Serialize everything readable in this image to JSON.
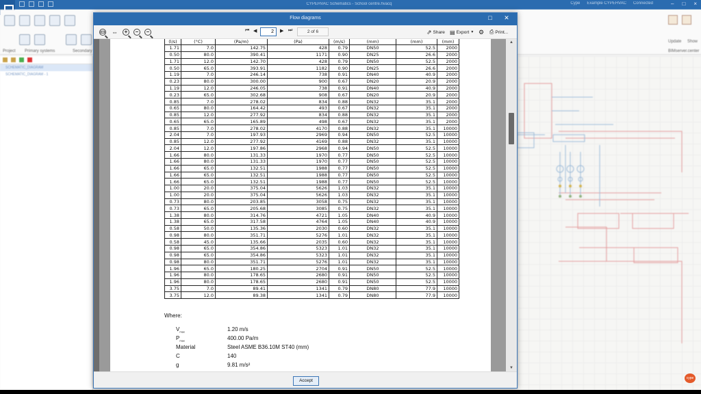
{
  "app": {
    "title": "CYPEHVAC Schematics - School centre.hvacq",
    "right_items": [
      "Cype",
      "Example CYPEHVAC",
      "Connected"
    ],
    "ribbon": {
      "left_group_label": "Primary systems",
      "right_group_label": "Secondary",
      "left_tab": "Project",
      "right_labels": [
        "Update",
        "Show"
      ],
      "right_section": "BIMserver.center"
    },
    "left_panel": {
      "rows": [
        "SCHEMATIC_DIAGRAM",
        "SCHEMATIC_DIAGRAM - 1"
      ]
    },
    "badge": "cype"
  },
  "dialog": {
    "title": "Flow diagrams",
    "toolbar": {
      "page_current": "2",
      "page_of": "2 of 6",
      "share_label": "Share",
      "export_label": "Export",
      "print_label": "Print..."
    },
    "accept_label": "Accept"
  },
  "report": {
    "units_header": [
      "(l/s)",
      "(°C)",
      "(Pa/m)",
      "(Pa)",
      "(m/s)",
      "(mm)",
      "(mm)",
      "(mm)"
    ],
    "rows": [
      [
        "1.71",
        "7.0",
        "142.75",
        "428",
        "0.79",
        "DN50",
        "52.5",
        "2000"
      ],
      [
        "0.50",
        "80.0",
        "390.41",
        "1171",
        "0.90",
        "DN25",
        "26.6",
        "2000"
      ],
      [
        "1.71",
        "12.0",
        "142.70",
        "428",
        "0.79",
        "DN50",
        "52.5",
        "2000"
      ],
      [
        "0.50",
        "65.0",
        "393.91",
        "1182",
        "0.90",
        "DN25",
        "26.6",
        "2000"
      ],
      [
        "1.19",
        "7.0",
        "246.14",
        "738",
        "0.91",
        "DN40",
        "40.9",
        "2000"
      ],
      [
        "0.23",
        "80.0",
        "300.00",
        "900",
        "0.67",
        "DN20",
        "20.9",
        "2000"
      ],
      [
        "1.19",
        "12.0",
        "246.05",
        "738",
        "0.91",
        "DN40",
        "40.9",
        "2000"
      ],
      [
        "0.23",
        "65.0",
        "302.68",
        "908",
        "0.67",
        "DN20",
        "20.9",
        "2000"
      ],
      [
        "0.85",
        "7.0",
        "278.02",
        "834",
        "0.88",
        "DN32",
        "35.1",
        "2000"
      ],
      [
        "0.65",
        "80.0",
        "164.42",
        "493",
        "0.67",
        "DN32",
        "35.1",
        "2000"
      ],
      [
        "0.85",
        "12.0",
        "277.92",
        "834",
        "0.88",
        "DN32",
        "35.1",
        "2000"
      ],
      [
        "0.65",
        "65.0",
        "165.89",
        "498",
        "0.67",
        "DN32",
        "35.1",
        "2000"
      ],
      [
        "0.85",
        "7.0",
        "278.02",
        "4170",
        "0.88",
        "DN32",
        "35.1",
        "10000"
      ],
      [
        "2.04",
        "7.0",
        "197.93",
        "2969",
        "0.94",
        "DN50",
        "52.5",
        "10000"
      ],
      [
        "0.85",
        "12.0",
        "277.92",
        "4169",
        "0.88",
        "DN32",
        "35.1",
        "10000"
      ],
      [
        "2.04",
        "12.0",
        "197.86",
        "2968",
        "0.94",
        "DN50",
        "52.5",
        "10000"
      ],
      [
        "1.66",
        "80.0",
        "131.33",
        "1970",
        "0.77",
        "DN50",
        "52.5",
        "10000"
      ],
      [
        "1.66",
        "80.0",
        "131.33",
        "1970",
        "0.77",
        "DN50",
        "52.5",
        "10000"
      ],
      [
        "1.66",
        "65.0",
        "132.51",
        "1988",
        "0.77",
        "DN50",
        "52.5",
        "10000"
      ],
      [
        "1.66",
        "65.0",
        "132.51",
        "1988",
        "0.77",
        "DN50",
        "52.5",
        "10000"
      ],
      [
        "1.66",
        "65.0",
        "132.51",
        "1988",
        "0.77",
        "DN50",
        "52.5",
        "10000"
      ],
      [
        "1.00",
        "20.0",
        "375.04",
        "5626",
        "1.03",
        "DN32",
        "35.1",
        "10000"
      ],
      [
        "1.00",
        "20.0",
        "375.04",
        "5626",
        "1.03",
        "DN32",
        "35.1",
        "10000"
      ],
      [
        "0.73",
        "80.0",
        "203.85",
        "3058",
        "0.75",
        "DN32",
        "35.1",
        "10000"
      ],
      [
        "0.73",
        "65.0",
        "205.68",
        "3085",
        "0.75",
        "DN32",
        "35.1",
        "10000"
      ],
      [
        "1.38",
        "80.0",
        "314.76",
        "4721",
        "1.05",
        "DN40",
        "40.9",
        "10000"
      ],
      [
        "1.38",
        "65.0",
        "317.58",
        "4764",
        "1.05",
        "DN40",
        "40.9",
        "10000"
      ],
      [
        "0.58",
        "50.0",
        "135.36",
        "2030",
        "0.60",
        "DN32",
        "35.1",
        "10000"
      ],
      [
        "0.98",
        "80.0",
        "351.71",
        "5276",
        "1.01",
        "DN32",
        "35.1",
        "10000"
      ],
      [
        "0.58",
        "45.0",
        "135.66",
        "2035",
        "0.60",
        "DN32",
        "35.1",
        "10000"
      ],
      [
        "0.98",
        "65.0",
        "354.86",
        "5323",
        "1.01",
        "DN32",
        "35.1",
        "10000"
      ],
      [
        "0.98",
        "65.0",
        "354.86",
        "5323",
        "1.01",
        "DN32",
        "35.1",
        "10000"
      ],
      [
        "0.98",
        "80.0",
        "351.71",
        "5276",
        "1.01",
        "DN32",
        "35.1",
        "10000"
      ],
      [
        "1.96",
        "65.0",
        "180.25",
        "2704",
        "0.91",
        "DN50",
        "52.5",
        "10000"
      ],
      [
        "1.96",
        "80.0",
        "178.65",
        "2680",
        "0.91",
        "DN50",
        "52.5",
        "10000"
      ],
      [
        "1.96",
        "80.0",
        "178.65",
        "2680",
        "0.91",
        "DN50",
        "52.5",
        "10000"
      ],
      [
        "3.75",
        "7.0",
        "89.41",
        "1341",
        "0.79",
        "DN80",
        "77.9",
        "10000"
      ],
      [
        "3.75",
        "12.0",
        "89.38",
        "1341",
        "0.79",
        "DN80",
        "77.9",
        "10000"
      ]
    ],
    "where_label": "Where:",
    "params": [
      {
        "name": "V",
        "sub": "max",
        "value": "1.20 m/s"
      },
      {
        "name": "P",
        "sub": "max",
        "value": "400.00 Pa/m"
      },
      {
        "name": "Material",
        "sub": "",
        "value": "Steel ASME B36.10M ST40 (mm)"
      },
      {
        "name": "C",
        "sub": "",
        "value": "140"
      },
      {
        "name": "g",
        "sub": "",
        "value": "9.81 m/s²"
      }
    ]
  }
}
